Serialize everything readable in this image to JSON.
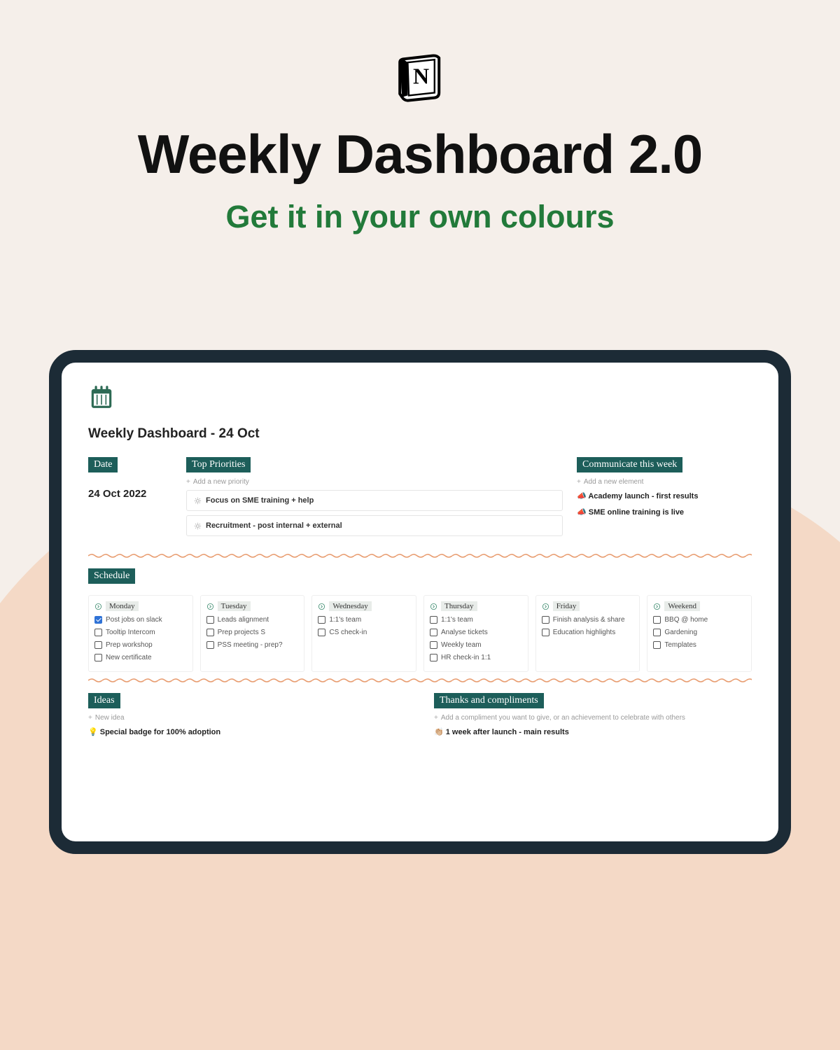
{
  "hero": {
    "title": "Weekly Dashboard 2.0",
    "subtitle": "Get it in your own colours"
  },
  "page": {
    "title": "Weekly Dashboard - 24 Oct"
  },
  "sections": {
    "date": {
      "label": "Date",
      "value": "24 Oct 2022"
    },
    "priorities": {
      "label": "Top Priorities",
      "add_text": "Add a new priority",
      "items": [
        "Focus on SME training + help",
        "Recruitment - post internal + external"
      ]
    },
    "communicate": {
      "label": "Communicate this week",
      "add_text": "Add a new element",
      "items": [
        "📣 Academy launch - first results",
        "📣 SME online training is live"
      ]
    },
    "schedule": {
      "label": "Schedule",
      "days": [
        {
          "name": "Monday",
          "tasks": [
            {
              "text": "Post jobs on slack",
              "done": true
            },
            {
              "text": "Tooltip Intercom",
              "done": false
            },
            {
              "text": "Prep  workshop",
              "done": false
            },
            {
              "text": "New certificate",
              "done": false
            }
          ]
        },
        {
          "name": "Tuesday",
          "tasks": [
            {
              "text": "Leads alignment",
              "done": false
            },
            {
              "text": "Prep projects S",
              "done": false
            },
            {
              "text": "PSS meeting - prep?",
              "done": false
            }
          ]
        },
        {
          "name": "Wednesday",
          "tasks": [
            {
              "text": "1:1's team",
              "done": false
            },
            {
              "text": "CS check-in",
              "done": false
            }
          ]
        },
        {
          "name": "Thursday",
          "tasks": [
            {
              "text": "1:1's team",
              "done": false
            },
            {
              "text": "Analyse tickets",
              "done": false
            },
            {
              "text": "Weekly team",
              "done": false
            },
            {
              "text": "HR check-in 1:1",
              "done": false
            }
          ]
        },
        {
          "name": "Friday",
          "tasks": [
            {
              "text": "Finish analysis & share",
              "done": false
            },
            {
              "text": "Education highlights",
              "done": false
            }
          ]
        },
        {
          "name": "Weekend",
          "tasks": [
            {
              "text": "BBQ @ home",
              "done": false
            },
            {
              "text": "Gardening",
              "done": false
            },
            {
              "text": "Templates",
              "done": false
            }
          ]
        }
      ]
    },
    "ideas": {
      "label": "Ideas",
      "add_text": "New idea",
      "items": [
        "💡 Special badge for 100% adoption"
      ]
    },
    "thanks": {
      "label": "Thanks and compliments",
      "add_text": "Add a compliment you want to give, or an achievement to celebrate with others",
      "items": [
        "👏🏼 1 week after launch - main results"
      ]
    }
  }
}
